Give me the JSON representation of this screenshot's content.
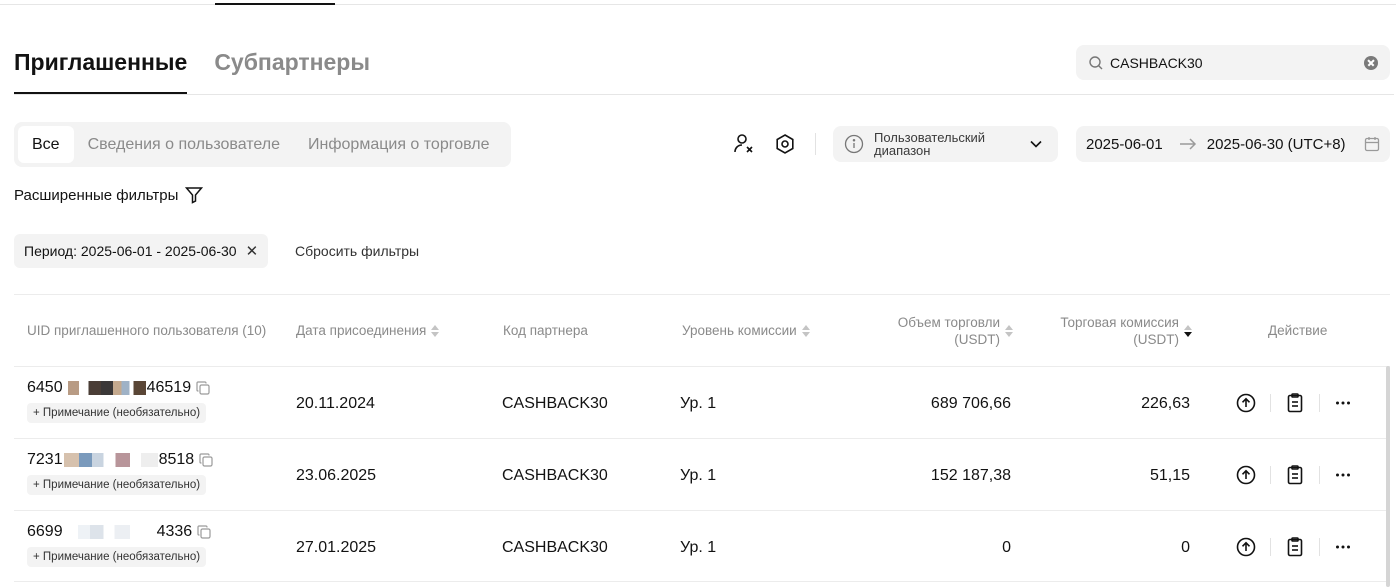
{
  "tabs": {
    "invited": "Приглашенные",
    "subpartners": "Субпартнеры"
  },
  "search": {
    "value": "CASHBACK30"
  },
  "segments": [
    "Все",
    "Сведения о пользователе",
    "Информация о торговле"
  ],
  "range_select": {
    "label": "Пользовательский диапазон"
  },
  "date_range": {
    "start": "2025-06-01",
    "end": "2025-06-30 (UTC+8)"
  },
  "advanced_filters": "Расширенные фильтры",
  "chip": {
    "label": "Период: 2025-06-01 - 2025-06-30"
  },
  "reset_filters": "Сбросить фильтры",
  "columns": {
    "uid": "UID приглашенного пользователя (10)",
    "join_date": "Дата присоединения",
    "partner_code": "Код партнера",
    "commission_level": "Уровень комиссии",
    "volume_line1": "Объем торговли",
    "volume_line2": "(USDT)",
    "commission_line1": "Торговая комиссия",
    "commission_line2": "(USDT)",
    "action": "Действие"
  },
  "rows": [
    {
      "uid_prefix": "6450",
      "uid_suffix": "46519",
      "note": "+ Примечание (необязательно)",
      "date": "20.11.2024",
      "code": "CASHBACK30",
      "level": "Ур. 1",
      "volume": "689 706,66",
      "commission": "226,63"
    },
    {
      "uid_prefix": "7231",
      "uid_suffix": "8518",
      "note": "+ Примечание (необязательно)",
      "date": "23.06.2025",
      "code": "CASHBACK30",
      "level": "Ур. 1",
      "volume": "152 187,38",
      "commission": "51,15"
    },
    {
      "uid_prefix": "6699",
      "uid_suffix": "4336",
      "note": "+ Примечание (необязательно)",
      "date": "27.01.2025",
      "code": "CASHBACK30",
      "level": "Ур. 1",
      "volume": "0",
      "commission": "0"
    }
  ],
  "icons": {
    "search": "search-icon",
    "clear": "clear-icon",
    "remove_user": "user-remove-icon",
    "settings": "hexagon-settings-icon",
    "info": "info-icon",
    "chevron": "chevron-down-icon",
    "arrow": "arrow-right-icon",
    "calendar": "calendar-icon",
    "filter": "filter-icon",
    "copy": "copy-icon",
    "upload": "arrow-up-circle-icon",
    "clipboard": "clipboard-icon",
    "more": "more-horizontal-icon"
  }
}
